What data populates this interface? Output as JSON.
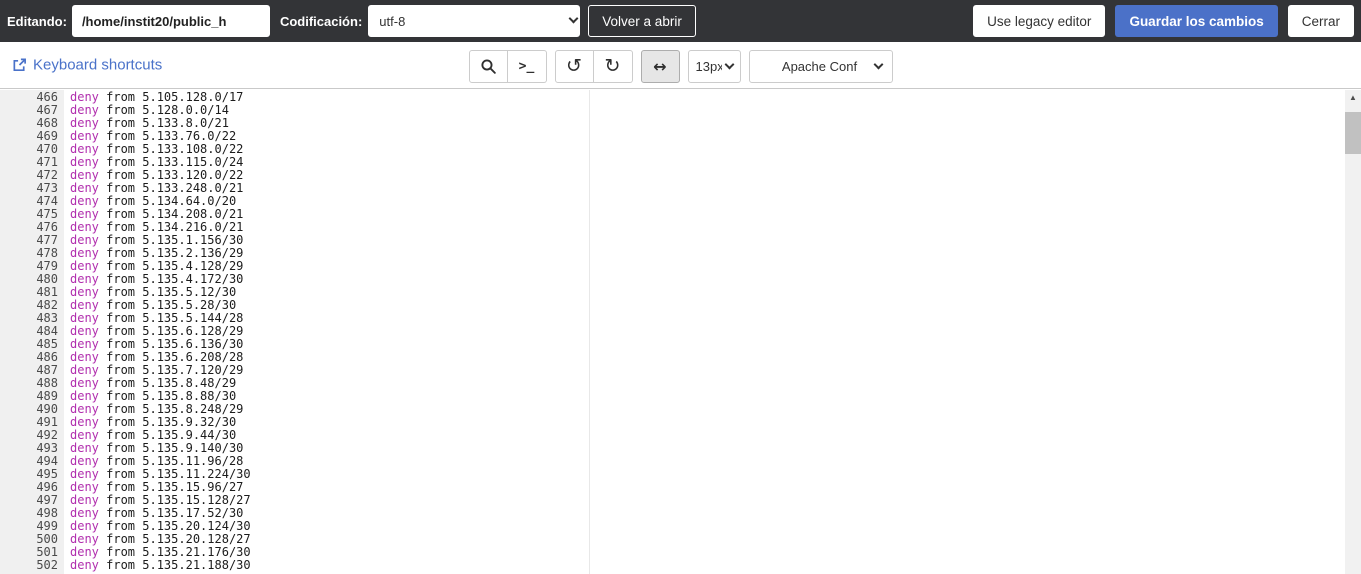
{
  "topbar": {
    "editing_label": "Editando:",
    "path_value": "/home/instit20/public_h",
    "encoding_label": "Codificación:",
    "encoding_value": "utf-8",
    "reopen_button": "Volver a abrir",
    "legacy_button": "Use legacy editor",
    "save_button": "Guardar los cambios",
    "close_button": "Cerrar",
    "bar_color": "#333437",
    "save_color": "#4b71c8"
  },
  "toolbar": {
    "shortcuts_link": "Keyboard shortcuts",
    "shortcuts_color": "#4a72c9",
    "font_size_value": "13px",
    "syntax_mode_value": "Apache Conf",
    "active_tool": "toggle-wrap"
  },
  "icons": {
    "external-link-icon": "open-in-new-window square with arrow",
    "search-icon": "magnifying glass",
    "terminal-icon": ">_",
    "undo-icon": "↺",
    "redo-icon": "↻",
    "wrap-icon": "↔",
    "scroll-up-icon": "▲"
  },
  "editor": {
    "keyword_color": "#b12fae",
    "text_color": "#1c1c1c",
    "gutter_color": "#f0f0f0",
    "lines": [
      {
        "number": 466,
        "text": "deny from 5.105.128.0/17"
      },
      {
        "number": 467,
        "text": "deny from 5.128.0.0/14"
      },
      {
        "number": 468,
        "text": "deny from 5.133.8.0/21"
      },
      {
        "number": 469,
        "text": "deny from 5.133.76.0/22"
      },
      {
        "number": 470,
        "text": "deny from 5.133.108.0/22"
      },
      {
        "number": 471,
        "text": "deny from 5.133.115.0/24"
      },
      {
        "number": 472,
        "text": "deny from 5.133.120.0/22"
      },
      {
        "number": 473,
        "text": "deny from 5.133.248.0/21"
      },
      {
        "number": 474,
        "text": "deny from 5.134.64.0/20"
      },
      {
        "number": 475,
        "text": "deny from 5.134.208.0/21"
      },
      {
        "number": 476,
        "text": "deny from 5.134.216.0/21"
      },
      {
        "number": 477,
        "text": "deny from 5.135.1.156/30"
      },
      {
        "number": 478,
        "text": "deny from 5.135.2.136/29"
      },
      {
        "number": 479,
        "text": "deny from 5.135.4.128/29"
      },
      {
        "number": 480,
        "text": "deny from 5.135.4.172/30"
      },
      {
        "number": 481,
        "text": "deny from 5.135.5.12/30"
      },
      {
        "number": 482,
        "text": "deny from 5.135.5.28/30"
      },
      {
        "number": 483,
        "text": "deny from 5.135.5.144/28"
      },
      {
        "number": 484,
        "text": "deny from 5.135.6.128/29"
      },
      {
        "number": 485,
        "text": "deny from 5.135.6.136/30"
      },
      {
        "number": 486,
        "text": "deny from 5.135.6.208/28"
      },
      {
        "number": 487,
        "text": "deny from 5.135.7.120/29"
      },
      {
        "number": 488,
        "text": "deny from 5.135.8.48/29"
      },
      {
        "number": 489,
        "text": "deny from 5.135.8.88/30"
      },
      {
        "number": 490,
        "text": "deny from 5.135.8.248/29"
      },
      {
        "number": 491,
        "text": "deny from 5.135.9.32/30"
      },
      {
        "number": 492,
        "text": "deny from 5.135.9.44/30"
      },
      {
        "number": 493,
        "text": "deny from 5.135.9.140/30"
      },
      {
        "number": 494,
        "text": "deny from 5.135.11.96/28"
      },
      {
        "number": 495,
        "text": "deny from 5.135.11.224/30"
      },
      {
        "number": 496,
        "text": "deny from 5.135.15.96/27"
      },
      {
        "number": 497,
        "text": "deny from 5.135.15.128/27"
      },
      {
        "number": 498,
        "text": "deny from 5.135.17.52/30"
      },
      {
        "number": 499,
        "text": "deny from 5.135.20.124/30"
      },
      {
        "number": 500,
        "text": "deny from 5.135.20.128/27"
      },
      {
        "number": 501,
        "text": "deny from 5.135.21.176/30"
      },
      {
        "number": 502,
        "text": "deny from 5.135.21.188/30"
      }
    ]
  }
}
